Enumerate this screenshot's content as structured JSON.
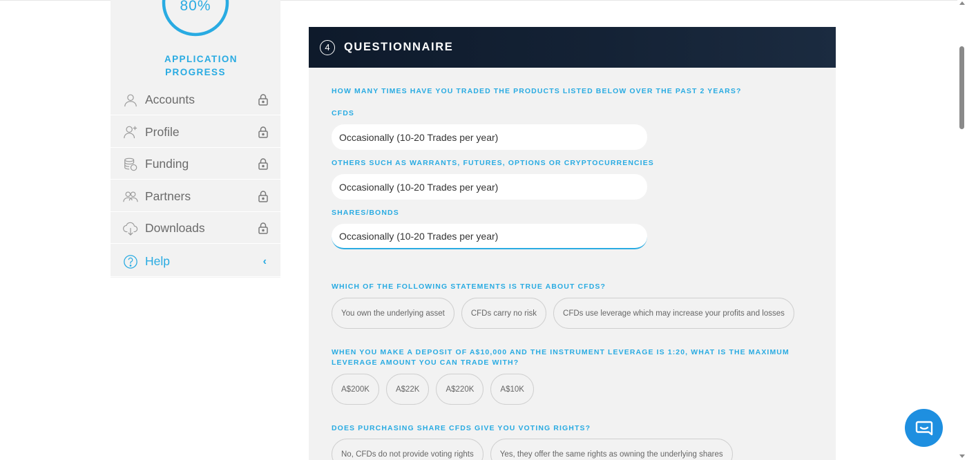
{
  "sidebar": {
    "progress_value": "80%",
    "progress_fraction": 0.8,
    "progress_label": "APPLICATION PROGRESS",
    "items": [
      {
        "label": "Accounts",
        "icon": "user-icon",
        "locked": true
      },
      {
        "label": "Profile",
        "icon": "user-plus-icon",
        "locked": true
      },
      {
        "label": "Funding",
        "icon": "coins-icon",
        "locked": true
      },
      {
        "label": "Partners",
        "icon": "users-icon",
        "locked": true
      },
      {
        "label": "Downloads",
        "icon": "cloud-download-icon",
        "locked": true
      }
    ],
    "help": {
      "label": "Help",
      "icon": "help-circle-icon"
    }
  },
  "questionnaire": {
    "step": "4",
    "title": "QUESTIONNAIRE",
    "trade_question": "HOW MANY TIMES HAVE YOU TRADED THE PRODUCTS LISTED BELOW OVER THE PAST 2 YEARS?",
    "cfds_label": "CFDS",
    "cfds_value": "Occasionally (10-20 Trades per year)",
    "others_label": "OTHERS SUCH AS WARRANTS, FUTURES, OPTIONS OR CRYPTOCURRENCIES",
    "others_value": "Occasionally (10-20 Trades per year)",
    "shares_label": "SHARES/BONDS",
    "shares_value": "Occasionally (10-20 Trades per year)",
    "cfd_statement_question": "WHICH OF THE FOLLOWING STATEMENTS IS TRUE ABOUT CFDS?",
    "cfd_statement_options": [
      "You own the underlying asset",
      "CFDs carry no risk",
      "CFDs use leverage which may increase your profits and losses"
    ],
    "leverage_question": "WHEN YOU MAKE A DEPOSIT OF A$10,000 AND THE INSTRUMENT LEVERAGE IS 1:20, WHAT IS THE MAXIMUM LEVERAGE AMOUNT YOU CAN TRADE WITH?",
    "leverage_options": [
      "A$200K",
      "A$22K",
      "A$220K",
      "A$10K"
    ],
    "voting_question": "DOES PURCHASING SHARE CFDS GIVE YOU VOTING RIGHTS?",
    "voting_options": [
      "No, CFDs do not provide voting rights",
      "Yes, they offer the same rights as owning the underlying shares"
    ]
  },
  "colors": {
    "accent": "#29abe2",
    "header_bg": "#0e1a2b",
    "panel_bg": "#f2f2f2",
    "chat_button": "#1e8fe0"
  },
  "chat": {
    "icon": "chat-bubble-icon"
  }
}
